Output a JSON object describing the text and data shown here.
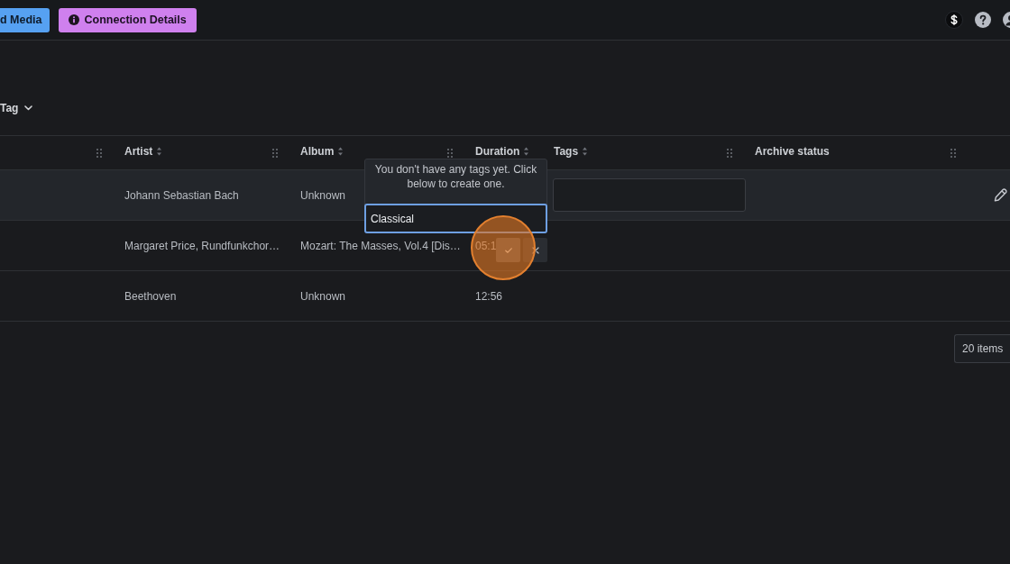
{
  "top_bar": {
    "buttons": [
      {
        "label": "d Media",
        "kind": "upload"
      },
      {
        "label": "Connection Details",
        "kind": "info"
      }
    ]
  },
  "filter": {
    "label": "Tag"
  },
  "table": {
    "columns": [
      {
        "handle": true
      },
      {
        "label": "Artist",
        "sortable": true,
        "handle": true
      },
      {
        "label": "Album",
        "sortable": true,
        "handle": true
      },
      {
        "label": "Duration",
        "sortable": true
      },
      {
        "label": "Tags",
        "sortable": true,
        "handle": true
      },
      {
        "label": "Archive status",
        "handle": true
      }
    ],
    "rows": [
      {
        "editing": true,
        "artist": "Johann Sebastian Bach",
        "album": "Unknown"
      },
      {
        "editing": false,
        "artist": "Margaret Price, Rundfunkchor…",
        "album": "Mozart: The Masses, Vol.4 [Dis…",
        "duration": "05:1"
      },
      {
        "editing": false,
        "artist": "Beethoven",
        "album": "Unknown",
        "duration": "12:56"
      }
    ]
  },
  "tag_popover": {
    "message": "You don't have any tags yet. Click below to create one.",
    "value": "Classical"
  },
  "pagination": {
    "page_size": "20 items"
  }
}
